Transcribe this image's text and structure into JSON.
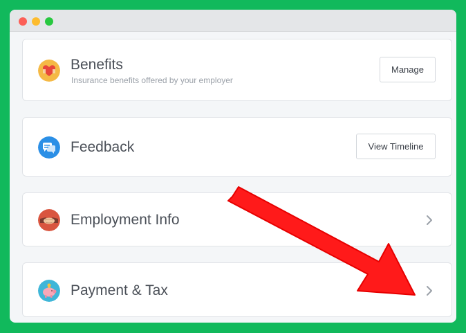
{
  "window": {
    "controls": [
      "close",
      "minimize",
      "maximize"
    ]
  },
  "cards": {
    "benefits": {
      "title": "Benefits",
      "subtitle": "Insurance benefits offered by your employer",
      "button_label": "Manage",
      "icon": "heart-icon",
      "icon_color": "#f5b945"
    },
    "feedback": {
      "title": "Feedback",
      "button_label": "View Timeline",
      "icon": "chat-bubbles-icon",
      "icon_color": "#2b8fe6"
    },
    "employment": {
      "title": "Employment Info",
      "icon": "handshake-icon",
      "icon_color": "#d9553f",
      "action_icon": "chevron-right-icon"
    },
    "payment": {
      "title": "Payment & Tax",
      "icon": "piggy-bank-icon",
      "icon_color": "#3fb6d8",
      "action_icon": "chevron-right-icon"
    }
  },
  "annotation": {
    "arrow_color": "#ff1a1a",
    "points_to": "payment-chevron"
  }
}
